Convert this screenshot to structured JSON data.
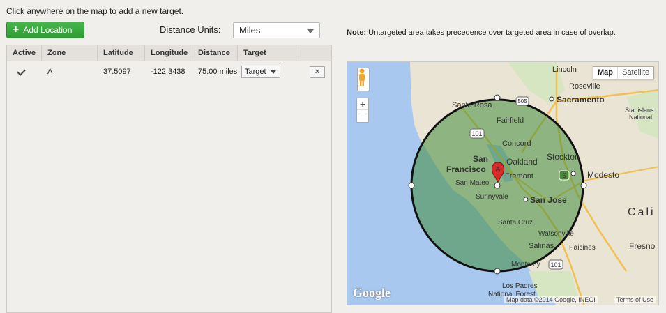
{
  "instruction": "Click anywhere on the map to add a new target.",
  "add_button": {
    "label": "Add Location"
  },
  "distance_units": {
    "label": "Distance Units:",
    "value": "Miles"
  },
  "table": {
    "headers": [
      "Active",
      "Zone",
      "Latitude",
      "Longitude",
      "Distance",
      "Target"
    ],
    "rows": [
      {
        "active": true,
        "zone": "A",
        "latitude": "37.5097",
        "longitude": "-122.3438",
        "distance": "75.00 miles",
        "target": "Target"
      }
    ],
    "delete_label": "×"
  },
  "note": {
    "prefix": "Note:",
    "text": " Untargeted area takes precedence over targeted area in case of overlap."
  },
  "map": {
    "type_buttons": {
      "map": "Map",
      "satellite": "Satellite"
    },
    "zoom": {
      "in": "+",
      "out": "−"
    },
    "logo": "Google",
    "attribution": "Map data ©2014 Google, INEGI",
    "terms": "Terms of Use",
    "marker_label": "A",
    "places": {
      "lincoln": "Lincoln",
      "roseville": "Roseville",
      "sacramento": "Sacramento",
      "santa_rosa": "Santa Rosa",
      "fairfield": "Fairfield",
      "concord": "Concord",
      "san": "San",
      "francisco": "Francisco",
      "oakland": "Oakland",
      "stockton": "Stockton",
      "modesto": "Modesto",
      "san_mateo": "San Mateo",
      "fremont": "Fremont",
      "sunnyvale": "Sunnyvale",
      "san_jose": "San Jose",
      "santa_cruz": "Santa Cruz",
      "watsonville": "Watsonville",
      "salinas": "Salinas",
      "paicines": "Paicines",
      "monterey": "Monterey",
      "stanislaus": "Stanislaus",
      "national": "National",
      "calif": "Cali",
      "fresno": "Fresno",
      "los_padres": "Los Padres",
      "national_forest": "National Forest",
      "hwy_505": "505",
      "hwy_101a": "101",
      "hwy_5": "5",
      "hwy_101b": "101"
    }
  }
}
